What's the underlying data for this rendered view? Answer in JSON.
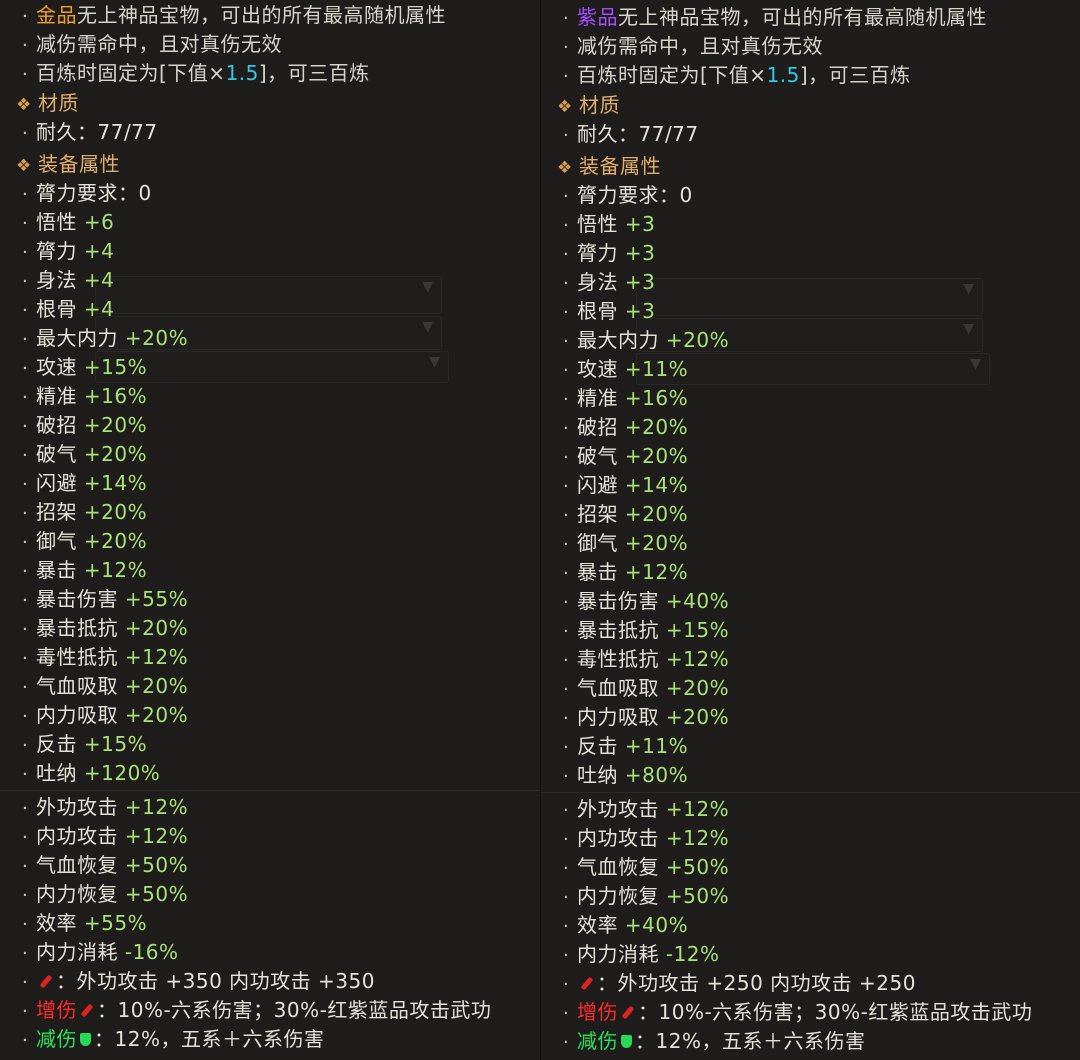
{
  "left": {
    "intro": {
      "quality_word": "金品",
      "line1_rest": "无上神品宝物，可出的所有最高随机属性",
      "line2": "减伤需命中，且对真伤无效",
      "line3_pre": "百炼时固定为[下值×",
      "line3_num": "1.5",
      "line3_post": "]，可三百炼"
    },
    "material_heading": "材质",
    "durability": "耐久：77/77",
    "attr_heading": "装备属性",
    "requirement": "膂力要求：0",
    "attrs": [
      {
        "name": "悟性",
        "value": "+6"
      },
      {
        "name": "膂力",
        "value": "+4"
      },
      {
        "name": "身法",
        "value": "+4"
      },
      {
        "name": "根骨",
        "value": "+4"
      },
      {
        "name": "最大内力",
        "value": "+20%"
      },
      {
        "name": "攻速",
        "value": "+15%"
      },
      {
        "name": "精准",
        "value": "+16%"
      },
      {
        "name": "破招",
        "value": "+20%"
      },
      {
        "name": "破气",
        "value": "+20%"
      },
      {
        "name": "闪避",
        "value": "+14%"
      },
      {
        "name": "招架",
        "value": "+20%"
      },
      {
        "name": "御气",
        "value": "+20%"
      },
      {
        "name": "暴击",
        "value": "+12%"
      },
      {
        "name": "暴击伤害",
        "value": "+55%"
      },
      {
        "name": "暴击抵抗",
        "value": "+20%"
      },
      {
        "name": "毒性抵抗",
        "value": "+12%"
      },
      {
        "name": "气血吸取",
        "value": "+20%"
      },
      {
        "name": "内力吸取",
        "value": "+20%"
      },
      {
        "name": "反击",
        "value": "+15%"
      },
      {
        "name": "吐纳",
        "value": "+120%"
      }
    ],
    "attrs2": [
      {
        "name": "外功攻击",
        "value": "+12%"
      },
      {
        "name": "内功攻击",
        "value": "+12%"
      },
      {
        "name": "气血恢复",
        "value": "+50%"
      },
      {
        "name": "内力恢复",
        "value": "+50%"
      },
      {
        "name": "效率",
        "value": "+55%"
      },
      {
        "name": "内力消耗",
        "value": "-16%"
      }
    ],
    "weapon_line": "：外功攻击 +350  内功攻击 +350",
    "dmg_up_label": "增伤",
    "dmg_up_text": "：10%-六系伤害；30%-红紫蓝品攻击武功",
    "dmg_down_label": "减伤",
    "dmg_down_text": "：12%，五系＋六系伤害"
  },
  "right": {
    "intro": {
      "quality_word": "紫品",
      "line1_rest": "无上神品宝物，可出的所有最高随机属性",
      "line2": "减伤需命中，且对真伤无效",
      "line3_pre": "百炼时固定为[下值×",
      "line3_num": "1.5",
      "line3_post": "]，可三百炼"
    },
    "material_heading": "材质",
    "durability": "耐久：77/77",
    "attr_heading": "装备属性",
    "requirement": "膂力要求：0",
    "attrs": [
      {
        "name": "悟性",
        "value": "+3"
      },
      {
        "name": "膂力",
        "value": "+3"
      },
      {
        "name": "身法",
        "value": "+3"
      },
      {
        "name": "根骨",
        "value": "+3"
      },
      {
        "name": "最大内力",
        "value": "+20%"
      },
      {
        "name": "攻速",
        "value": "+11%"
      },
      {
        "name": "精准",
        "value": "+16%"
      },
      {
        "name": "破招",
        "value": "+20%"
      },
      {
        "name": "破气",
        "value": "+20%"
      },
      {
        "name": "闪避",
        "value": "+14%"
      },
      {
        "name": "招架",
        "value": "+20%"
      },
      {
        "name": "御气",
        "value": "+20%"
      },
      {
        "name": "暴击",
        "value": "+12%"
      },
      {
        "name": "暴击伤害",
        "value": "+40%"
      },
      {
        "name": "暴击抵抗",
        "value": "+15%"
      },
      {
        "name": "毒性抵抗",
        "value": "+12%"
      },
      {
        "name": "气血吸取",
        "value": "+20%"
      },
      {
        "name": "内力吸取",
        "value": "+20%"
      },
      {
        "name": "反击",
        "value": "+11%"
      },
      {
        "name": "吐纳",
        "value": "+80%"
      }
    ],
    "attrs2": [
      {
        "name": "外功攻击",
        "value": "+12%"
      },
      {
        "name": "内功攻击",
        "value": "+12%"
      },
      {
        "name": "气血恢复",
        "value": "+50%"
      },
      {
        "name": "内力恢复",
        "value": "+50%"
      },
      {
        "name": "效率",
        "value": "+40%"
      },
      {
        "name": "内力消耗",
        "value": "-12%"
      }
    ],
    "weapon_line": "：外功攻击 +250  内功攻击 +250",
    "dmg_up_label": "增伤",
    "dmg_up_text": "：10%-六系伤害；30%-红紫蓝品攻击武功",
    "dmg_down_label": "减伤",
    "dmg_down_text": "：12%，五系＋六系伤害"
  },
  "colors": {
    "gold_quality": "#f2a026",
    "purple_quality": "#a64dff",
    "heading": "#e0ad6c",
    "attr_green": "#a8e07a",
    "damage_up_red": "#ff2a2a",
    "damage_down_green": "#2ee05a"
  },
  "icons": {
    "heading_marker": "diamond-ornament-icon",
    "weapon_marker": "sword-icon",
    "defense_marker": "shield-icon"
  }
}
